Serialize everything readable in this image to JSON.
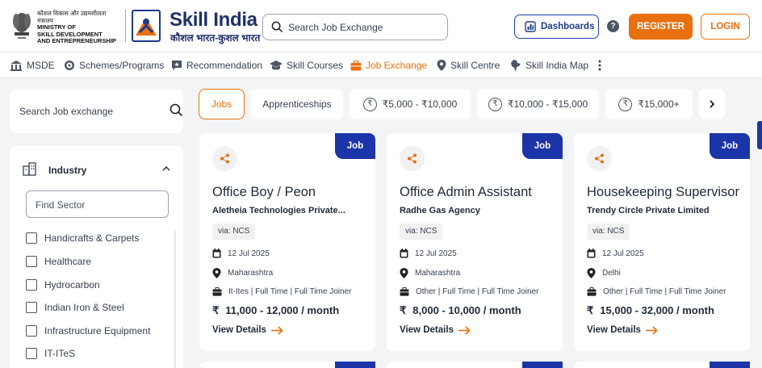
{
  "header": {
    "ministry_hindi": "कौशल विकास और उद्यमशीलता मंत्रालय",
    "ministry_line1": "MINISTRY OF",
    "ministry_line2": "SKILL DEVELOPMENT",
    "ministry_line3": "AND ENTREPRENEURSHIP",
    "brand_title": "Skill India",
    "brand_subtitle": "कौशल भारत-कुशल भारत",
    "search_placeholder": "Search  Job Exchange",
    "dashboards_label": "Dashboards",
    "help_label": "?",
    "register_label": "REGISTER",
    "login_label": "LOGIN"
  },
  "nav": {
    "items": [
      {
        "label": "MSDE",
        "icon": "building-icon"
      },
      {
        "label": "Schemes/Programs",
        "icon": "target-icon"
      },
      {
        "label": "Recommendation",
        "icon": "chat-star-icon"
      },
      {
        "label": "Skill Courses",
        "icon": "graduation-cap-icon"
      },
      {
        "label": "Job Exchange",
        "icon": "briefcase-icon",
        "active": true
      },
      {
        "label": "Skill Centre",
        "icon": "location-pin-icon"
      },
      {
        "label": "Skill India Map",
        "icon": "india-map-icon"
      }
    ],
    "more_icon": "more-vertical-icon"
  },
  "sidebar": {
    "search_placeholder": "Search Job exchange",
    "industry_label": "Industry",
    "find_sector_placeholder": "Find Sector",
    "sectors": [
      "Handicrafts & Carpets",
      "Healthcare",
      "Hydrocarbon",
      "Indian Iron & Steel",
      "Infrastructure Equipment",
      "IT-ITeS"
    ]
  },
  "filters": {
    "jobs": "Jobs",
    "apprenticeships": "Apprenticeships",
    "salary_1": "₹5,000 - ₹10,000",
    "salary_2": "₹10,000 - ₹15,000",
    "salary_3": "₹15,000+",
    "rupee_symbol": "₹",
    "next_icon": "chevron-right-icon"
  },
  "jobs": [
    {
      "badge": "Job",
      "title": "Office Boy / Peon",
      "company": "Aletheia Technologies Private...",
      "via": "via: NCS",
      "date": "12 Jul 2025",
      "location": "Maharashtra",
      "details": "It-Ites  |  Full Time  |  Full Time Joiner",
      "rupee": "₹",
      "salary": "11,000 - 12,000 / month",
      "view_details": "View Details"
    },
    {
      "badge": "Job",
      "title": "Office Admin Assistant",
      "company": "Radhe Gas Agency",
      "via": "via: NCS",
      "date": "12 Jul 2025",
      "location": "Maharashtra",
      "details": "Other  |  Full Time  |  Full Time Joiner",
      "rupee": "₹",
      "salary": "8,000 - 10,000 / month",
      "view_details": "View Details"
    },
    {
      "badge": "Job",
      "title": "Housekeeping Supervisor",
      "company": "Trendy Circle Private Limited",
      "via": "via: NCS",
      "date": "12 Jul 2025",
      "location": "Delhi",
      "details": "Other  |  Full Time  |  Full Time Joiner",
      "rupee": "₹",
      "salary": "15,000 - 32,000 / month",
      "view_details": "View Details"
    }
  ],
  "colors": {
    "accent": "#e8700e",
    "brand_blue": "#1b35a8",
    "navy_text": "#1e2f6b"
  }
}
